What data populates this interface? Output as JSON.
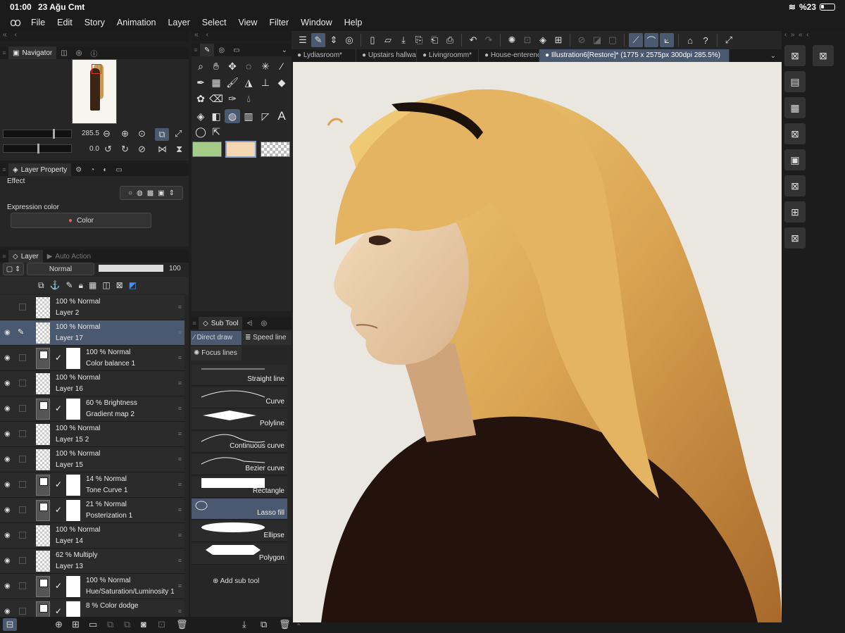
{
  "status": {
    "time": "01:00",
    "date": "23 Ağu Cmt",
    "battery": "%23"
  },
  "menu": [
    "File",
    "Edit",
    "Story",
    "Animation",
    "Layer",
    "Select",
    "View",
    "Filter",
    "Window",
    "Help"
  ],
  "navigator": {
    "tab": "Navigator",
    "zoom": "285.5",
    "rotation": "0.0"
  },
  "layer_property": {
    "tab": "Layer Property",
    "effect_label": "Effect",
    "expression_label": "Expression color",
    "expression_value": "Color"
  },
  "layer_panel": {
    "tab": "Layer",
    "tab2": "Auto Action",
    "blend_mode": "Normal",
    "opacity": "100",
    "layers": [
      {
        "line1": "100 % Normal",
        "line2": "Layer 2",
        "kind": "raster",
        "visible": false,
        "selected": false
      },
      {
        "line1": "100 % Normal",
        "line2": "Layer 17",
        "kind": "raster",
        "visible": true,
        "selected": true
      },
      {
        "line1": "100 % Normal",
        "line2": "Color balance 1",
        "kind": "adjust",
        "visible": true,
        "selected": false
      },
      {
        "line1": "100 % Normal",
        "line2": "Layer 16",
        "kind": "raster",
        "visible": true,
        "selected": false
      },
      {
        "line1": "60 % Brightness",
        "line2": "Gradient map 2",
        "kind": "adjust",
        "visible": true,
        "selected": false
      },
      {
        "line1": "100 % Normal",
        "line2": "Layer 15 2",
        "kind": "raster",
        "visible": true,
        "selected": false
      },
      {
        "line1": "100 % Normal",
        "line2": "Layer 15",
        "kind": "raster",
        "visible": true,
        "selected": false
      },
      {
        "line1": "14 % Normal",
        "line2": "Tone Curve 1",
        "kind": "adjust",
        "visible": true,
        "selected": false
      },
      {
        "line1": "21 % Normal",
        "line2": "Posterization 1",
        "kind": "adjust",
        "visible": true,
        "selected": false
      },
      {
        "line1": "100 % Normal",
        "line2": "Layer 14",
        "kind": "raster",
        "visible": true,
        "selected": false
      },
      {
        "line1": "62 % Multiply",
        "line2": "Layer 13",
        "kind": "raster",
        "visible": true,
        "selected": false
      },
      {
        "line1": "100 % Normal",
        "line2": "Hue/Saturation/Luminosity 1",
        "kind": "adjust",
        "visible": true,
        "selected": false
      },
      {
        "line1": "8 % Color dodge",
        "line2": "",
        "kind": "adjust",
        "visible": true,
        "selected": false
      }
    ]
  },
  "colors": {
    "main": "#a6cc8a",
    "sub": "#f4d6b0",
    "accent": "#4a5870"
  },
  "sub_tool": {
    "tab": "Sub Tool",
    "groups": [
      "Direct draw",
      "Speed line",
      "Focus lines"
    ],
    "items": [
      "Straight line",
      "Curve",
      "Polyline",
      "Continuous curve",
      "Bezier curve",
      "Rectangle",
      "Lasso fill",
      "Ellipse",
      "Polygon"
    ],
    "add_label": "Add sub tool"
  },
  "doc_tabs": [
    "Lydiasroom*",
    "Upstairs hallway",
    "Livingroomm*",
    "House-enterence",
    "Illustration6[Restore]* (1775 x 2575px 300dpi 285.5%)"
  ]
}
